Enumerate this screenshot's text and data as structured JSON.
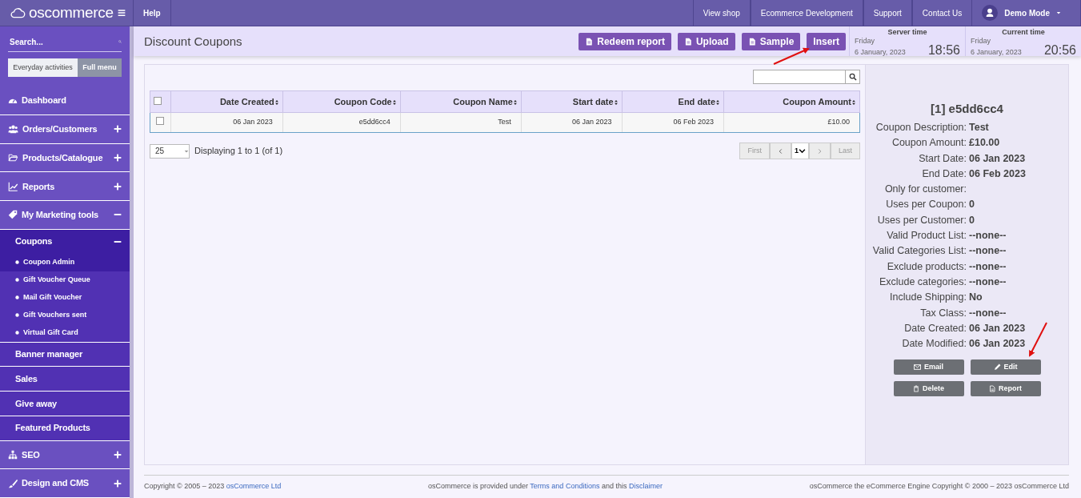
{
  "brand": {
    "name": "oscommerce"
  },
  "top_nav": {
    "left": [
      "Help"
    ],
    "right": [
      "View shop",
      "Ecommerce Development",
      "Support",
      "Contact Us"
    ],
    "user": "Demo Mode"
  },
  "sidebar": {
    "search_placeholder": "Search...",
    "menu_modes": [
      {
        "label": "Everyday activities",
        "selected": false
      },
      {
        "label": "Full menu",
        "selected": true
      }
    ],
    "items": [
      {
        "kind": "section",
        "label": "Dashboard"
      },
      {
        "kind": "section",
        "label": "Orders/Customers",
        "expanded": false
      },
      {
        "kind": "section",
        "label": "Products/Catalogue",
        "expanded": false
      },
      {
        "kind": "section",
        "label": "Reports",
        "expanded": false
      },
      {
        "kind": "section",
        "label": "My Marketing tools",
        "expanded": true
      },
      {
        "kind": "group",
        "label": "Coupons",
        "expanded": true,
        "children": [
          {
            "label": "Coupon Admin",
            "selected": true
          },
          {
            "label": "Gift Voucher Queue",
            "selected": false
          },
          {
            "label": "Mail Gift Voucher",
            "selected": false
          },
          {
            "label": "Gift Vouchers sent",
            "selected": false
          },
          {
            "label": "Virtual Gift Card",
            "selected": false
          }
        ]
      },
      {
        "kind": "plain",
        "label": "Banner manager"
      },
      {
        "kind": "plain",
        "label": "Sales"
      },
      {
        "kind": "plain",
        "label": "Give away"
      },
      {
        "kind": "plain",
        "label": "Featured Products"
      },
      {
        "kind": "section",
        "label": "SEO",
        "expanded": false
      },
      {
        "kind": "section",
        "label": "Design and CMS",
        "expanded": false
      }
    ]
  },
  "header": {
    "title": "Discount Coupons",
    "buttons": [
      {
        "label": "Redeem report",
        "has_icon": true
      },
      {
        "label": "Upload",
        "has_icon": true
      },
      {
        "label": "Sample",
        "has_icon": true
      },
      {
        "label": "Insert",
        "has_icon": false
      }
    ],
    "clocks": [
      {
        "label": "Server time",
        "day": "Friday",
        "date": "6 January, 2023",
        "time": "18:56"
      },
      {
        "label": "Current time",
        "day": "Friday",
        "date": "6 January, 2023",
        "time": "20:56"
      }
    ]
  },
  "table": {
    "select_all_checked": false,
    "columns": [
      "Date Created",
      "Coupon Code",
      "Coupon Name",
      "Start date",
      "End date",
      "Coupon Amount"
    ],
    "rows": [
      {
        "checked": false,
        "selected": true,
        "cells": [
          "06 Jan 2023",
          "e5dd6cc4",
          "Test",
          "06 Jan 2023",
          "06 Feb 2023",
          "£10.00"
        ]
      }
    ],
    "page_size": "25",
    "displaying": "Displaying 1 to 1 (of 1)",
    "pagination": {
      "first": "First",
      "page": "1",
      "last": "Last",
      "prev_disabled": false,
      "next_disabled": true
    }
  },
  "details": {
    "title": "[1] e5dd6cc4",
    "fields": [
      {
        "label": "Coupon Description:",
        "value": "Test"
      },
      {
        "label": "Coupon Amount:",
        "value": "£10.00"
      },
      {
        "label": "Start Date:",
        "value": "06 Jan 2023"
      },
      {
        "label": "End Date:",
        "value": "06 Feb 2023"
      },
      {
        "label": "Only for customer:"
      },
      {
        "label": "Uses per Coupon:",
        "value": "0"
      },
      {
        "label": "Uses per Customer:",
        "value": "0"
      },
      {
        "label": "Valid Product List:",
        "value": "--none--"
      },
      {
        "label": "Valid Categories List:",
        "value": "--none--"
      },
      {
        "label": "Exclude products:",
        "value": "--none--"
      },
      {
        "label": "Exclude categories:",
        "value": "--none--"
      },
      {
        "label": "Include Shipping:",
        "value": "No"
      },
      {
        "label": "Tax Class:",
        "value": "--none--"
      },
      {
        "label": "Date Created:",
        "value": "06 Jan 2023"
      },
      {
        "label": "Date Modified:",
        "value": "06 Jan 2023"
      }
    ],
    "actions": [
      "Email",
      "Edit",
      "Delete",
      "Report"
    ]
  },
  "footer": {
    "left": {
      "text": "Copyright © 2005 – 2023",
      "link": "osCommerce Ltd"
    },
    "middle": [
      {
        "kind": "text",
        "text": "osCommerce is provided under"
      },
      {
        "kind": "link",
        "text": "Terms and Conditions"
      },
      {
        "kind": "text",
        "text": "and this"
      },
      {
        "kind": "link",
        "text": "Disclaimer"
      }
    ],
    "right": "osCommerce the eCommerce Engine Copyright © 2000 – 2023 osCommerce Ltd"
  }
}
